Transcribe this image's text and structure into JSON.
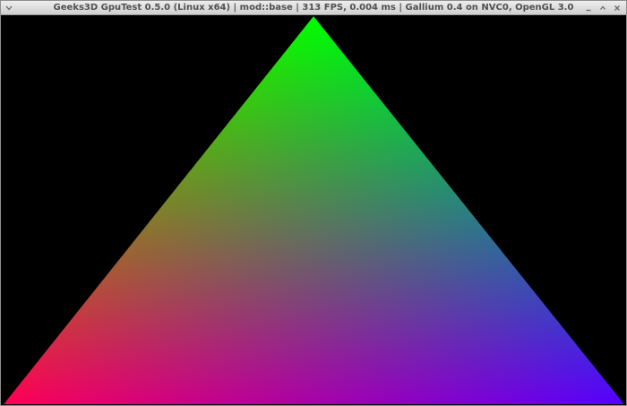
{
  "window": {
    "title": "Geeks3D GpuTest 0.5.0 (Linux x64) | mod::base | 313 FPS, 0.004 ms | Gallium 0.4 on NVC0, OpenGL 3.0",
    "menu_icon": "chevron-down-icon",
    "minimize_icon": "minimize-icon",
    "maximize_icon": "maximize-icon",
    "close_icon": "close-icon"
  },
  "scene": {
    "background_color": "#000000",
    "vertex_colors": {
      "top": "#00ff00",
      "bottom_left": "#ff0000",
      "bottom_right": "#0000ff"
    }
  }
}
